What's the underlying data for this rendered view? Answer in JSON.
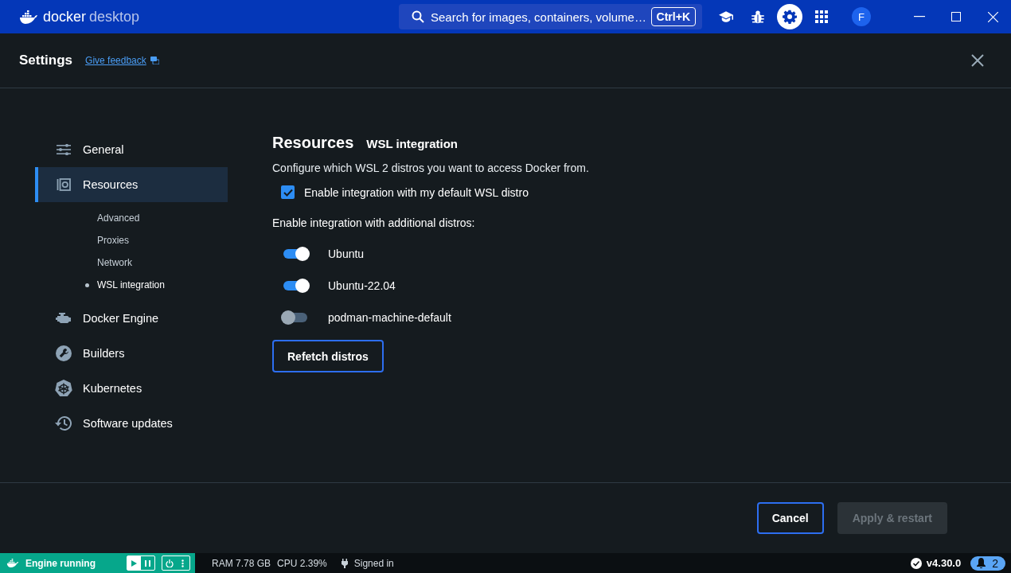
{
  "titlebar": {
    "logo_primary": "docker",
    "logo_secondary": "desktop",
    "search": {
      "placeholder": "Search for images, containers, volume…",
      "shortcut": "Ctrl+K"
    },
    "toolbar": [
      {
        "kind": "learn",
        "selected": false
      },
      {
        "kind": "bug",
        "selected": false
      },
      {
        "kind": "settings",
        "selected": true
      },
      {
        "kind": "apps",
        "selected": false
      }
    ],
    "avatar": "F"
  },
  "header": {
    "title": "Settings",
    "feedback_link": "Give feedback"
  },
  "sidebar": {
    "items": [
      {
        "kind": "general",
        "label": "General",
        "selected": false
      },
      {
        "kind": "resources",
        "label": "Resources",
        "selected": true,
        "children": [
          {
            "label": "Advanced",
            "selected": false
          },
          {
            "label": "Proxies",
            "selected": false
          },
          {
            "label": "Network",
            "selected": false
          },
          {
            "label": "WSL integration",
            "selected": true
          }
        ]
      },
      {
        "kind": "engine",
        "label": "Docker Engine",
        "selected": false
      },
      {
        "kind": "builders",
        "label": "Builders",
        "selected": false
      },
      {
        "kind": "kubernetes",
        "label": "Kubernetes",
        "selected": false
      },
      {
        "kind": "updates",
        "label": "Software updates",
        "selected": false
      }
    ]
  },
  "content": {
    "title": "Resources",
    "subtitle": "WSL integration",
    "description": "Configure which WSL 2 distros you want to access Docker from.",
    "default_distro": {
      "label": "Enable integration with my default WSL distro",
      "checked": true
    },
    "distros_label": "Enable integration with additional distros:",
    "distros": [
      {
        "name": "Ubuntu",
        "on": true
      },
      {
        "name": "Ubuntu-22.04",
        "on": true
      },
      {
        "name": "podman-machine-default",
        "on": false
      }
    ],
    "refetch_button": "Refetch distros"
  },
  "footer": {
    "buttons": [
      {
        "label": "Cancel",
        "disabled": false
      },
      {
        "label": "Apply & restart",
        "disabled": true
      }
    ]
  },
  "status_bar": {
    "engine": "Engine running",
    "ram": "RAM 7.78 GB",
    "cpu": "CPU 2.39%",
    "signed_in": "Signed in",
    "version": "v4.30.0",
    "notifications": "2"
  }
}
